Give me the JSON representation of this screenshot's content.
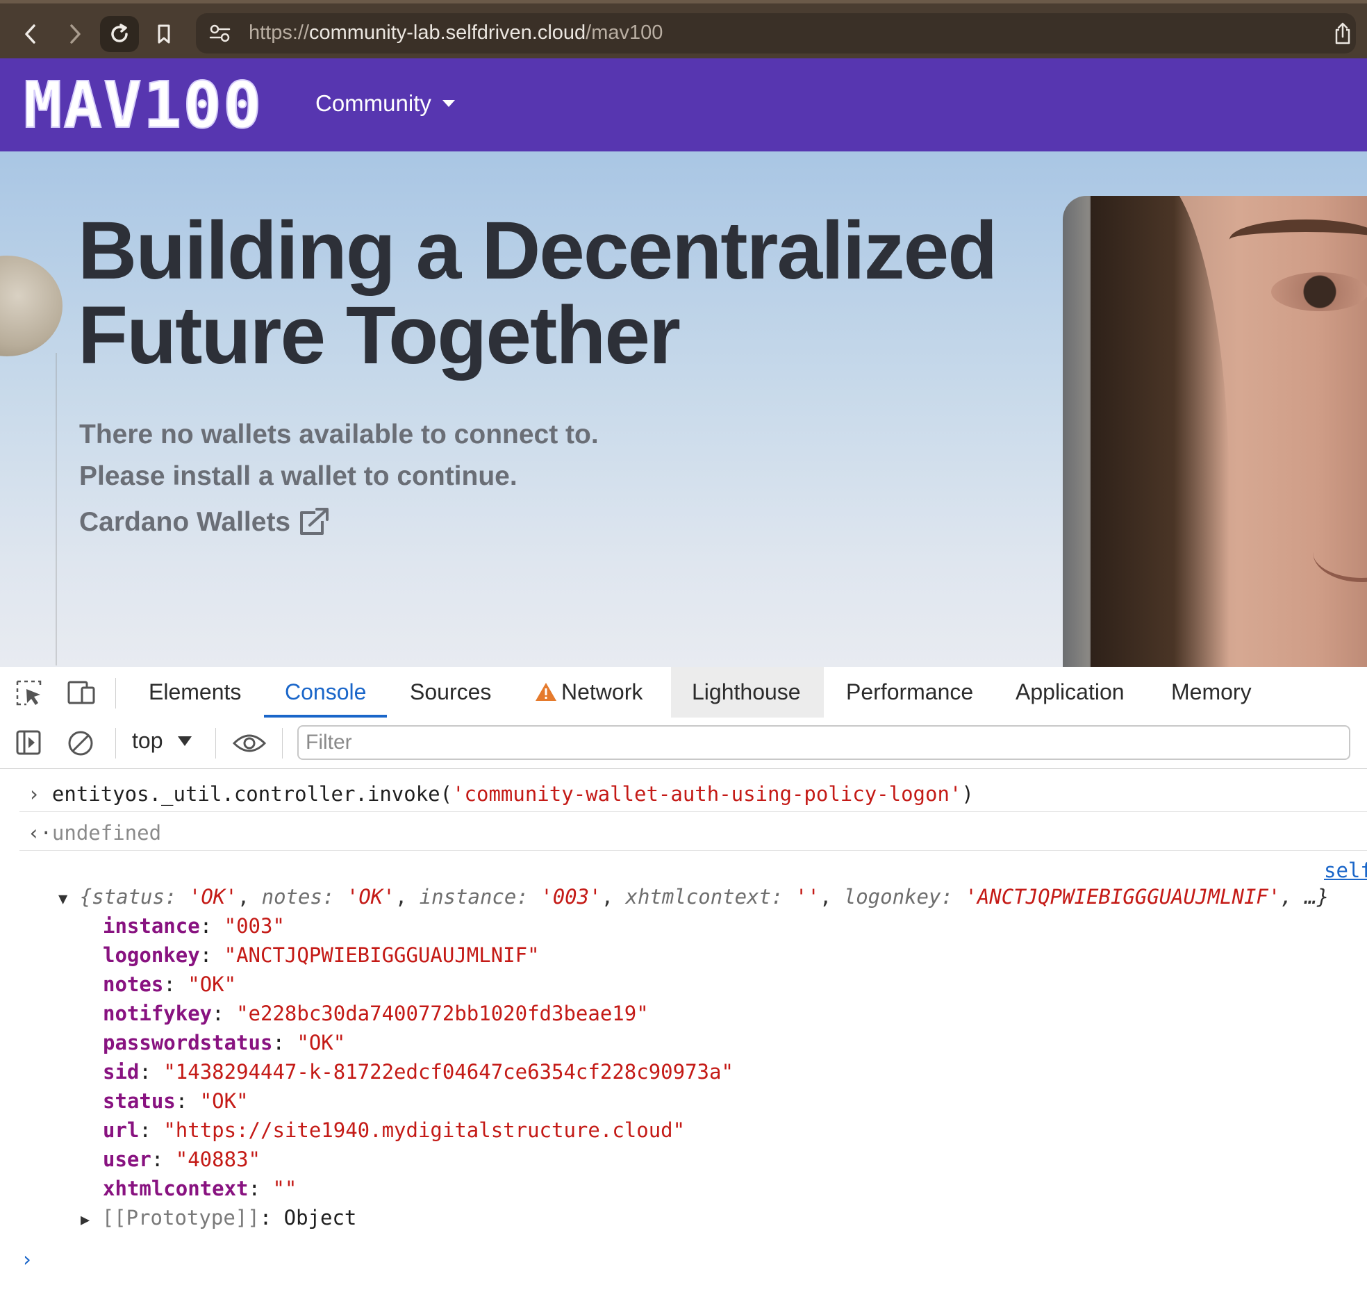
{
  "browser": {
    "url_scheme": "https://",
    "url_host": "community-lab.selfdriven.cloud",
    "url_path": "/mav100"
  },
  "site": {
    "logo": "MAV100",
    "nav_community": "Community"
  },
  "hero": {
    "title_line1": "Building a Decentralized",
    "title_line2": "Future Together",
    "message_line1": "There no wallets available to connect to.",
    "message_line2": "Please install a wallet to continue.",
    "wallet_link": "Cardano Wallets"
  },
  "devtools": {
    "tabs": [
      "Elements",
      "Console",
      "Sources",
      "Network",
      "Lighthouse",
      "Performance",
      "Application",
      "Memory"
    ],
    "active_tab": "Console",
    "context": "top",
    "filter_placeholder": "Filter"
  },
  "console": {
    "input_prefix": "entityos._util.controller.invoke(",
    "input_arg": "'community-wallet-auth-using-policy-logon'",
    "input_suffix": ")",
    "return_value": "undefined",
    "source_link": "self",
    "summary": {
      "open": "{",
      "items": [
        {
          "key": "status",
          "value": "'OK'"
        },
        {
          "key": "notes",
          "value": "'OK'"
        },
        {
          "key": "instance",
          "value": "'003'"
        },
        {
          "key": "xhtmlcontext",
          "value": "''"
        },
        {
          "key": "logonkey",
          "value": "'ANCTJQPWIEBIGGGUAUJMLNIF'"
        }
      ],
      "close": ", …}"
    },
    "properties": [
      {
        "key": "instance",
        "value": "\"003\""
      },
      {
        "key": "logonkey",
        "value": "\"ANCTJQPWIEBIGGGUAUJMLNIF\""
      },
      {
        "key": "notes",
        "value": "\"OK\""
      },
      {
        "key": "notifykey",
        "value": "\"e228bc30da7400772bb1020fd3beae19\""
      },
      {
        "key": "passwordstatus",
        "value": "\"OK\""
      },
      {
        "key": "sid",
        "value": "\"1438294447-k-81722edcf04647ce6354cf228c90973a\""
      },
      {
        "key": "status",
        "value": "\"OK\""
      },
      {
        "key": "url",
        "value": "\"https://site1940.mydigitalstructure.cloud\""
      },
      {
        "key": "user",
        "value": "\"40883\""
      },
      {
        "key": "xhtmlcontext",
        "value": "\"\""
      }
    ],
    "prototype_label": "[[Prototype]]",
    "prototype_value": "Object"
  },
  "colors": {
    "browser_bar": "#4a3d31",
    "site_header": "#5736b0",
    "devtools_accent": "#1a66c9",
    "string_red": "#c41a16",
    "key_purple": "#881280"
  },
  "icons": {
    "back": "chevron-left-icon",
    "forward": "chevron-right-icon",
    "reload": "reload-icon",
    "bookmark": "bookmark-icon",
    "site_settings": "tune-icon",
    "share": "share-icon",
    "external_link": "external-link-icon",
    "inspect": "inspect-element-icon",
    "device": "device-toolbar-icon",
    "warning": "warning-icon",
    "sidebar": "sidebar-toggle-icon",
    "clear": "clear-console-icon",
    "eye": "live-expression-icon"
  }
}
